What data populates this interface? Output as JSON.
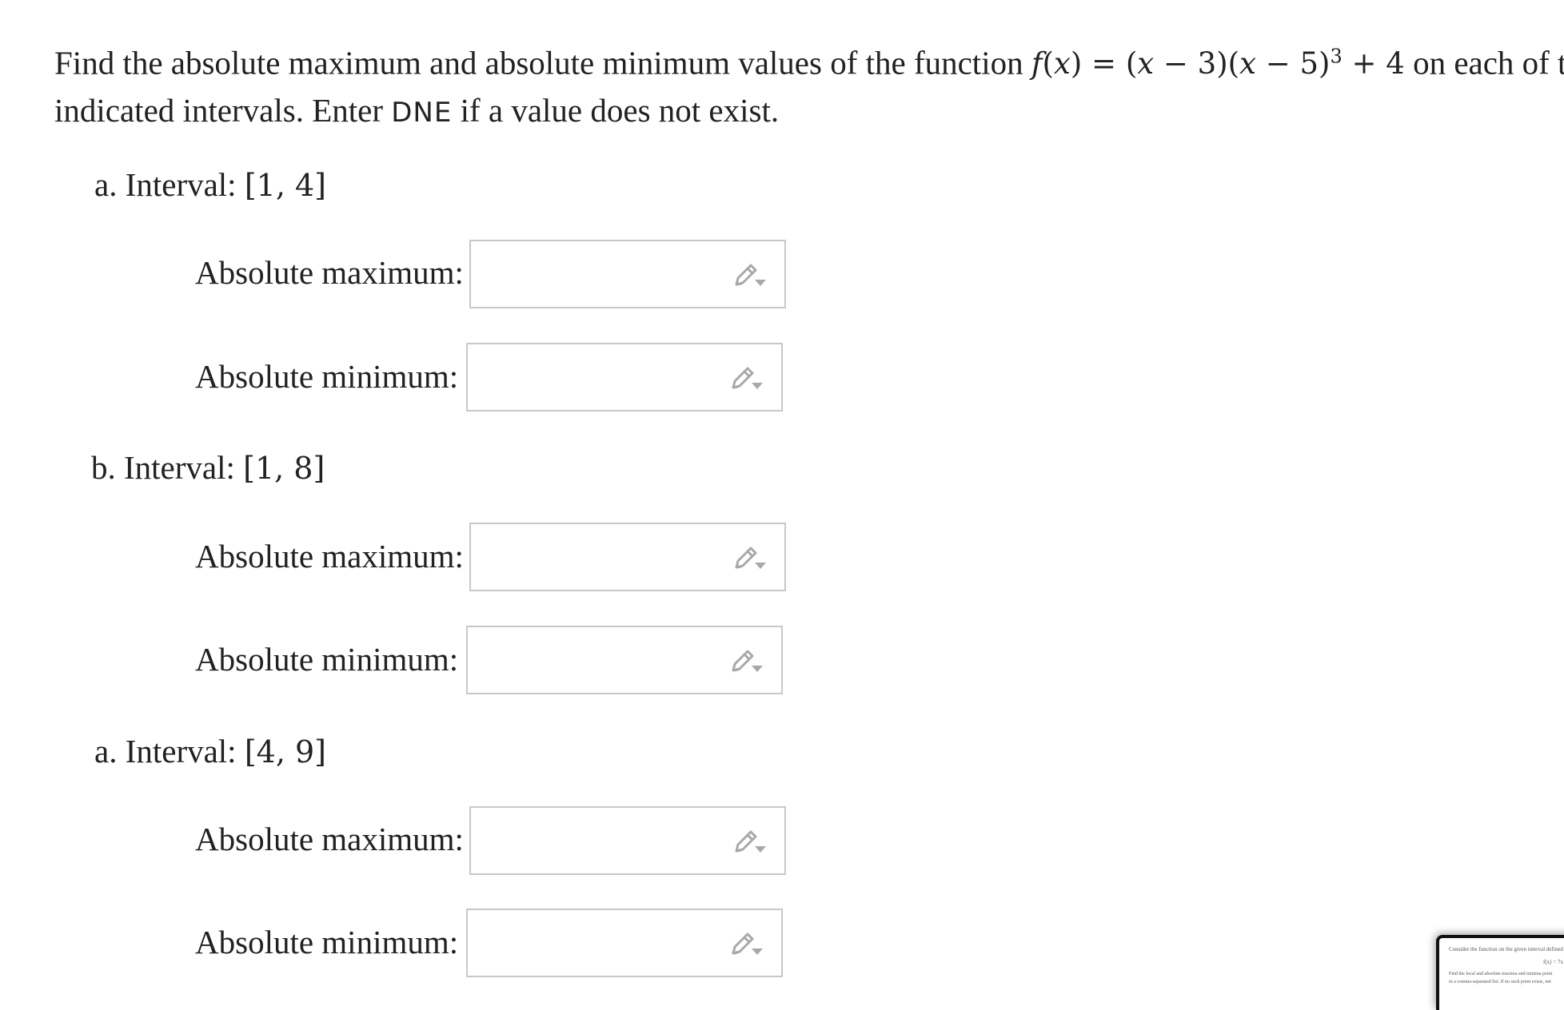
{
  "problem": {
    "text_before": "Find the absolute maximum and absolute minimum values of the function ",
    "math_f": "f",
    "math_x1": "x",
    "math_eq": ") = (",
    "math_x2": "x",
    "math_minus3": " − 3)(",
    "math_x3": "x",
    "math_minus5": " − 5)",
    "math_exp": "3",
    "math_plus4": " + 4",
    "text_after": " on each of th",
    "line2_before": "indicated intervals. Enter ",
    "dne": "DNE",
    "line2_after": " if a value does not exist."
  },
  "sections": [
    {
      "label": "a. Interval: ",
      "interval": "[1, 4]",
      "max_label": "Absolute maximum:",
      "min_label": "Absolute minimum:",
      "max_value": "",
      "min_value": ""
    },
    {
      "label": "b. Interval: ",
      "interval": "[1, 8]",
      "max_label": "Absolute maximum:",
      "min_label": "Absolute minimum:",
      "max_value": "",
      "min_value": ""
    },
    {
      "label": "a. Interval: ",
      "interval": "[4, 9]",
      "max_label": "Absolute maximum:",
      "min_label": "Absolute minimum:",
      "max_value": "",
      "min_value": ""
    }
  ],
  "icons": {
    "answer_tool": "pencil-dropdown-icon"
  },
  "colors": {
    "text": "#222222",
    "box_border": "#c8c8c8",
    "icon": "#a8a8a8"
  },
  "thumbnail": {
    "line1": "Consider the function on the given interval defined b",
    "line2": "f(x) = 7x",
    "line3": "Find the local and absolute maxima and minima point",
    "line4": "in a comma-separated list. If no such point exists, ent"
  }
}
